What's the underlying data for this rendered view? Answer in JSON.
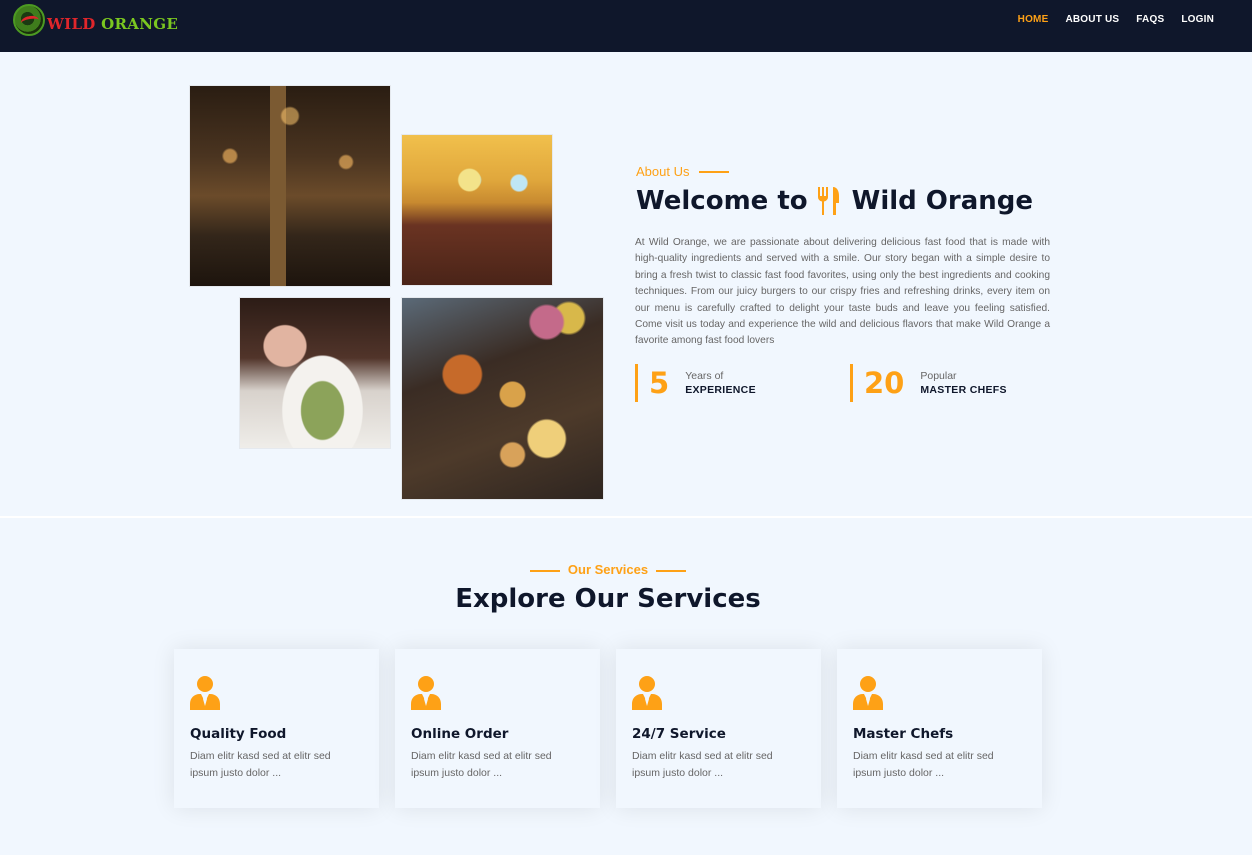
{
  "brand": {
    "logo_text_1": "WILD",
    "logo_text_2": "ORANGE"
  },
  "nav": {
    "items": [
      {
        "label": "HOME",
        "active": true
      },
      {
        "label": "ABOUT US",
        "active": false
      },
      {
        "label": "FAQS",
        "active": false
      },
      {
        "label": "LOGIN",
        "active": false
      }
    ]
  },
  "about": {
    "label": "About Us",
    "title_before": "Welcome to",
    "title_after": "Wild Orange",
    "title_icon": "utensils-icon",
    "text": "At Wild Orange, we are passionate about delivering delicious fast food that is made with high-quality ingredients and served with a smile. Our story began with a simple desire to bring a fresh twist to classic fast food favorites, using only the best ingredients and cooking techniques. From our juicy burgers to our crispy fries and refreshing drinks, every item on our menu is carefully crafted to delight your taste buds and leave you feeling satisfied. Come visit us today and experience the wild and delicious flavors that make Wild Orange a favorite among fast food lovers",
    "stats": [
      {
        "number": "5",
        "small": "Years of",
        "big": "EXPERIENCE"
      },
      {
        "number": "20",
        "small": "Popular",
        "big": "MASTER CHEFS"
      }
    ]
  },
  "services": {
    "label": "Our Services",
    "title": "Explore Our Services",
    "cards": [
      {
        "icon": "user-tie-icon",
        "title": "Quality Food",
        "desc": "Diam elitr kasd sed at elitr sed ipsum justo dolor ..."
      },
      {
        "icon": "user-tie-icon",
        "title": "Online Order",
        "desc": "Diam elitr kasd sed at elitr sed ipsum justo dolor ..."
      },
      {
        "icon": "user-tie-icon",
        "title": "24/7 Service",
        "desc": "Diam elitr kasd sed at elitr sed ipsum justo dolor ..."
      },
      {
        "icon": "user-tie-icon",
        "title": "Master Chefs",
        "desc": "Diam elitr kasd sed at elitr sed ipsum justo dolor ..."
      }
    ]
  },
  "colors": {
    "accent": "#fea116",
    "dark": "#0f172b",
    "background": "#f1f7fe",
    "body_text": "#666565"
  }
}
